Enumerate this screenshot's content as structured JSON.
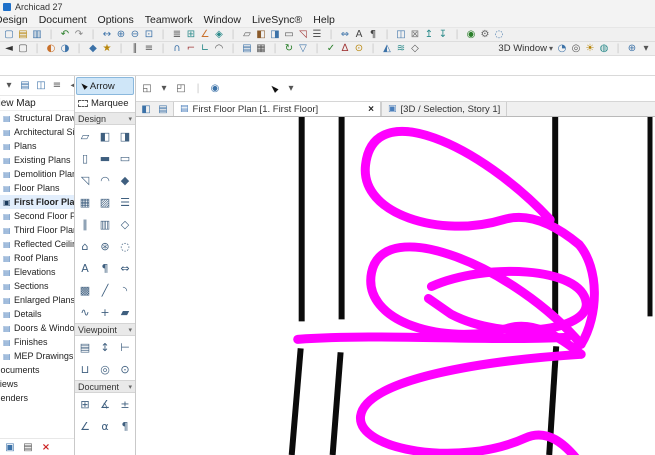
{
  "window": {
    "title": "Archicad 27"
  },
  "menu": {
    "items": [
      {
        "name": "menu-design",
        "label": "Design"
      },
      {
        "name": "menu-document",
        "label": "Document"
      },
      {
        "name": "menu-options",
        "label": "Options"
      },
      {
        "name": "menu-teamwork",
        "label": "Teamwork"
      },
      {
        "name": "menu-window",
        "label": "Window"
      },
      {
        "name": "menu-livesync",
        "label": "LiveSync®"
      },
      {
        "name": "menu-help",
        "label": "Help"
      }
    ]
  },
  "toolbars": {
    "row1": [
      {
        "name": "new-icon",
        "glyph": "▢",
        "color": "#3c72a8"
      },
      {
        "name": "open-icon",
        "glyph": "▤",
        "color": "#b8860b"
      },
      {
        "name": "save-icon",
        "glyph": "▥",
        "color": "#3c72a8"
      },
      {
        "name": "separator",
        "glyph": "|",
        "color": "#c8c8c8",
        "interactable": false
      },
      {
        "name": "undo-icon",
        "glyph": "↶",
        "color": "#2a7f2a"
      },
      {
        "name": "redo-icon",
        "glyph": "↷",
        "color": "#888888"
      },
      {
        "name": "separator",
        "glyph": "|",
        "color": "#c8c8c8",
        "interactable": false
      },
      {
        "name": "pan-icon",
        "glyph": "↔",
        "color": "#3c72a8"
      },
      {
        "name": "zoom-in-icon",
        "glyph": "⊕",
        "color": "#3c72a8"
      },
      {
        "name": "zoom-out-icon",
        "glyph": "⊖",
        "color": "#3c72a8"
      },
      {
        "name": "fit-in-window-icon",
        "glyph": "⊡",
        "color": "#3c72a8"
      },
      {
        "name": "separator",
        "glyph": "|",
        "color": "#c8c8c8",
        "interactable": false
      },
      {
        "name": "layers-icon",
        "glyph": "≣",
        "color": "#555555"
      },
      {
        "name": "grid-snap-icon",
        "glyph": "⊞",
        "color": "#2a8a8a"
      },
      {
        "name": "guide-lines-icon",
        "glyph": "∠",
        "color": "#c9702a"
      },
      {
        "name": "snap-points-icon",
        "glyph": "◈",
        "color": "#2a8a8a"
      },
      {
        "name": "separator",
        "glyph": "|",
        "color": "#c8c8c8",
        "interactable": false
      },
      {
        "name": "wall-icon",
        "glyph": "▱",
        "color": "#555555"
      },
      {
        "name": "door-icon",
        "glyph": "◧",
        "color": "#8a5a2a"
      },
      {
        "name": "window-icon",
        "glyph": "◨",
        "color": "#3c72a8"
      },
      {
        "name": "slab-icon",
        "glyph": "▭",
        "color": "#555555"
      },
      {
        "name": "roof-icon",
        "glyph": "◹",
        "color": "#a23a3a"
      },
      {
        "name": "stair-icon",
        "glyph": "☰",
        "color": "#555555"
      },
      {
        "name": "separator",
        "glyph": "|",
        "color": "#c8c8c8",
        "interactable": false
      },
      {
        "name": "dimension-icon",
        "glyph": "⇔",
        "color": "#3c72a8"
      },
      {
        "name": "text-icon",
        "glyph": "A",
        "color": "#444444"
      },
      {
        "name": "label-icon",
        "glyph": "¶",
        "color": "#444444"
      },
      {
        "name": "separator",
        "glyph": "|",
        "color": "#c8c8c8",
        "interactable": false
      },
      {
        "name": "group-icon",
        "glyph": "◫",
        "color": "#3c72a8"
      },
      {
        "name": "lock-icon",
        "glyph": "⊠",
        "color": "#777777"
      },
      {
        "name": "bring-forward-icon",
        "glyph": "↥",
        "color": "#2a8a8a"
      },
      {
        "name": "send-backward-icon",
        "glyph": "↧",
        "color": "#2a8a8a"
      },
      {
        "name": "separator",
        "glyph": "|",
        "color": "#c8c8c8",
        "interactable": false
      },
      {
        "name": "teamwork-icon",
        "glyph": "◉",
        "color": "#2a7f2a"
      },
      {
        "name": "settings-icon",
        "glyph": "⚙",
        "color": "#666666"
      },
      {
        "name": "search-icon",
        "glyph": "◌",
        "color": "#3c72a8"
      }
    ],
    "row2_left": [
      {
        "name": "arrow-tool-icon",
        "glyph": "◄",
        "color": "#333333"
      },
      {
        "name": "marquee-tool-icon",
        "glyph": "▢",
        "color": "#555555"
      },
      {
        "name": "separator",
        "glyph": "|",
        "color": "#c8c8c8",
        "interactable": false
      },
      {
        "name": "trace-reference-icon",
        "glyph": "◐",
        "color": "#c9702a"
      },
      {
        "name": "virtual-trace-icon",
        "glyph": "◑",
        "color": "#3c72a8"
      },
      {
        "name": "separator",
        "glyph": "|",
        "color": "#c8c8c8",
        "interactable": false
      },
      {
        "name": "element-settings-icon",
        "glyph": "◆",
        "color": "#3c72a8"
      },
      {
        "name": "favorites-icon",
        "glyph": "★",
        "color": "#b8860b"
      },
      {
        "name": "separator",
        "glyph": "|",
        "color": "#c8c8c8",
        "interactable": false
      },
      {
        "name": "align-icon",
        "glyph": "∥",
        "color": "#555555"
      },
      {
        "name": "distribute-icon",
        "glyph": "≡",
        "color": "#555555"
      },
      {
        "name": "separator",
        "glyph": "|",
        "color": "#c8c8c8",
        "interactable": false
      },
      {
        "name": "intersect-icon",
        "glyph": "∩",
        "color": "#3c72a8"
      },
      {
        "name": "trim-icon",
        "glyph": "⌐",
        "color": "#a23a3a"
      },
      {
        "name": "adjust-icon",
        "glyph": "∟",
        "color": "#2a8a8a"
      },
      {
        "name": "fillet-icon",
        "glyph": "◠",
        "color": "#555555"
      },
      {
        "name": "separator",
        "glyph": "|",
        "color": "#c8c8c8",
        "interactable": false
      },
      {
        "name": "stories-icon",
        "glyph": "▤",
        "color": "#3c72a8"
      },
      {
        "name": "layers-dialog-icon",
        "glyph": "▦",
        "color": "#555555"
      },
      {
        "name": "separator",
        "glyph": "|",
        "color": "#c8c8c8",
        "interactable": false
      },
      {
        "name": "renovation-icon",
        "glyph": "↻",
        "color": "#2a7f2a"
      },
      {
        "name": "filter-icon",
        "glyph": "▽",
        "color": "#3c72a8"
      },
      {
        "name": "separator",
        "glyph": "|",
        "color": "#c8c8c8",
        "interactable": false
      },
      {
        "name": "mark-up-icon",
        "glyph": "✓",
        "color": "#2a7f2a"
      },
      {
        "name": "change-manager-icon",
        "glyph": "∆",
        "color": "#a23a3a"
      },
      {
        "name": "issue-icon",
        "glyph": "⊙",
        "color": "#b8860b"
      },
      {
        "name": "separator",
        "glyph": "|",
        "color": "#c8c8c8",
        "interactable": false
      },
      {
        "name": "profile-manager-icon",
        "glyph": "◭",
        "color": "#3c72a8"
      },
      {
        "name": "attributes-icon",
        "glyph": "≋",
        "color": "#2a8a8a"
      },
      {
        "name": "ifc-icon",
        "glyph": "◇",
        "color": "#555555"
      }
    ],
    "row2_label": "3D Window",
    "row2_caret": "▾",
    "row2_right": [
      {
        "name": "3d-style-icon",
        "glyph": "◔",
        "color": "#3c72a8"
      },
      {
        "name": "camera-icon",
        "glyph": "◎",
        "color": "#555555"
      },
      {
        "name": "sun-study-icon",
        "glyph": "☀",
        "color": "#b8860b"
      },
      {
        "name": "render-icon",
        "glyph": "◍",
        "color": "#2a8a8a"
      },
      {
        "name": "separator",
        "glyph": "|",
        "color": "#c8c8c8",
        "interactable": false
      },
      {
        "name": "zoom-level-icon",
        "glyph": "⊕",
        "color": "#3c72a8"
      },
      {
        "name": "dropdown-caret-icon",
        "glyph": "▾",
        "color": "#555555"
      }
    ]
  },
  "navigator": {
    "header": "View Map",
    "top_icons": [
      {
        "name": "project-chooser-icon",
        "glyph": "▾",
        "color": "#555555"
      },
      {
        "name": "navigator-map-icon",
        "glyph": "▤",
        "color": "#3c72a8"
      },
      {
        "name": "organizer-icon",
        "glyph": "◫",
        "color": "#3c72a8"
      },
      {
        "name": "pin-panel-icon",
        "glyph": "≡",
        "color": "#555555"
      },
      {
        "name": "collapse-panel-icon",
        "glyph": "◂",
        "color": "#555555"
      }
    ],
    "tree": [
      {
        "name": "tree-item-structural-drawings",
        "glyph": "▤",
        "label": "Structural Drawings"
      },
      {
        "name": "tree-item-architectural-site",
        "glyph": "▤",
        "label": "Architectural Site"
      },
      {
        "name": "tree-item-plans",
        "glyph": "▤",
        "label": "Plans"
      },
      {
        "name": "tree-item-existing-plans",
        "glyph": "▤",
        "label": "Existing Plans"
      },
      {
        "name": "tree-item-demolition-plans",
        "glyph": "▤",
        "label": "Demolition Plans"
      },
      {
        "name": "tree-item-floor-plans",
        "glyph": "▤",
        "label": "Floor Plans"
      },
      {
        "name": "tree-item-first-floor-plan",
        "glyph": "▣",
        "label": "First Floor Plan",
        "selected": true
      },
      {
        "name": "tree-item-second-floor-plan",
        "glyph": "▤",
        "label": "Second Floor Plan"
      },
      {
        "name": "tree-item-third-floor-plan",
        "glyph": "▤",
        "label": "Third Floor Plan"
      },
      {
        "name": "tree-item-reflected-ceiling-plans",
        "glyph": "▤",
        "label": "Reflected Ceiling Plans"
      },
      {
        "name": "tree-item-roof-plans",
        "glyph": "▤",
        "label": "Roof Plans"
      },
      {
        "name": "tree-item-elevations",
        "glyph": "▤",
        "label": "Elevations"
      },
      {
        "name": "tree-item-sections",
        "glyph": "▤",
        "label": "Sections"
      },
      {
        "name": "tree-item-enlarged-plans",
        "glyph": "▤",
        "label": "Enlarged Plans"
      },
      {
        "name": "tree-item-details",
        "glyph": "▤",
        "label": "Details"
      },
      {
        "name": "tree-item-doors-windows",
        "glyph": "▤",
        "label": "Doors & Windows"
      },
      {
        "name": "tree-item-finishes",
        "glyph": "▤",
        "label": "Finishes"
      },
      {
        "name": "tree-item-mep-drawings",
        "glyph": "▤",
        "label": "MEP Drawings"
      },
      {
        "name": "tree-item-documents",
        "glyph": "",
        "label": "Documents",
        "cls": "root"
      },
      {
        "name": "tree-item-views",
        "glyph": "",
        "label": "Views",
        "cls": "root"
      },
      {
        "name": "tree-item-renders",
        "glyph": "",
        "label": "Renders",
        "cls": "root"
      }
    ],
    "bottom_icons": [
      {
        "name": "view-settings-icon",
        "glyph": "▣",
        "color": "#3c72a8"
      },
      {
        "name": "clone-folder-icon",
        "glyph": "▤",
        "color": "#555555"
      },
      {
        "name": "delete-view-icon",
        "glyph": "×",
        "color": "#cc2222"
      }
    ]
  },
  "toolbox": {
    "arrow_icon": "◄",
    "arrow_label": "Arrow",
    "marquee_label": "Marquee",
    "section_caret": "▾",
    "design": {
      "title": "Design",
      "items": [
        {
          "name": "wall-tool-icon",
          "glyph": "▱"
        },
        {
          "name": "door-tool-icon",
          "glyph": "◧"
        },
        {
          "name": "window-tool-icon",
          "glyph": "◨"
        },
        {
          "name": "column-tool-icon",
          "glyph": "▯"
        },
        {
          "name": "beam-tool-icon",
          "glyph": "▬"
        },
        {
          "name": "slab-tool-icon",
          "glyph": "▭"
        },
        {
          "name": "roof-tool-icon",
          "glyph": "◹"
        },
        {
          "name": "shell-tool-icon",
          "glyph": "◠"
        },
        {
          "name": "morph-tool-icon",
          "glyph": "◆"
        },
        {
          "name": "mesh-tool-icon",
          "glyph": "▦"
        },
        {
          "name": "zone-tool-icon",
          "glyph": "▨"
        },
        {
          "name": "stair-tool-icon",
          "glyph": "☰"
        },
        {
          "name": "railing-tool-icon",
          "glyph": "∥"
        },
        {
          "name": "curtain-wall-tool-icon",
          "glyph": "▥"
        },
        {
          "name": "skylight-tool-icon",
          "glyph": "◇"
        },
        {
          "name": "object-tool-icon",
          "glyph": "⌂"
        },
        {
          "name": "lamp-tool-icon",
          "glyph": "⊛"
        },
        {
          "name": "opening-tool-icon",
          "glyph": "◌"
        },
        {
          "name": "text-tool-icon",
          "glyph": "A"
        },
        {
          "name": "label-tool-icon",
          "glyph": "¶"
        },
        {
          "name": "dimension-tool-icon",
          "glyph": "⇔"
        },
        {
          "name": "fill-tool-icon",
          "glyph": "▩"
        },
        {
          "name": "line-tool-icon",
          "glyph": "╱"
        },
        {
          "name": "arc-tool-icon",
          "glyph": "◝"
        },
        {
          "name": "spline-tool-icon",
          "glyph": "∿"
        },
        {
          "name": "hotspot-tool-icon",
          "glyph": "+"
        },
        {
          "name": "figure-tool-icon",
          "glyph": "▰"
        }
      ]
    },
    "viewpoint": {
      "title": "Viewpoint",
      "items": [
        {
          "name": "story-tool-icon",
          "glyph": "▤"
        },
        {
          "name": "section-tool-icon",
          "glyph": "↕"
        },
        {
          "name": "elevation-tool-icon",
          "glyph": "⊢"
        },
        {
          "name": "interior-elevation-tool-icon",
          "glyph": "⊔"
        },
        {
          "name": "camera-tool-icon",
          "glyph": "◎"
        },
        {
          "name": "detail-tool-icon",
          "glyph": "⊙"
        }
      ]
    },
    "document": {
      "title": "Document",
      "items": [
        {
          "name": "drawing-tool-icon",
          "glyph": "⊞"
        },
        {
          "name": "worksheet-tool-icon",
          "glyph": "∡"
        },
        {
          "name": "level-dimension-tool-icon",
          "glyph": "±"
        },
        {
          "name": "angle-dimension-tool-icon",
          "glyph": "∠"
        },
        {
          "name": "text-annotation-tool-icon",
          "glyph": "α"
        },
        {
          "name": "label-annotation-tool-icon",
          "glyph": "¶"
        }
      ]
    }
  },
  "options_bar": {
    "icons": [
      {
        "name": "selection-style-icon",
        "glyph": "◱",
        "color": "#555555"
      },
      {
        "name": "dropdown-caret-icon",
        "glyph": "▾",
        "color": "#555555"
      },
      {
        "name": "marquee-style-icon",
        "glyph": "◰",
        "color": "#555555"
      },
      {
        "name": "separator",
        "glyph": "|",
        "color": "#c8c8c8",
        "interactable": false
      },
      {
        "name": "snap-guides-icon",
        "glyph": "◉",
        "color": "#3c72a8"
      },
      {
        "name": "arrow-cursor-icon",
        "glyph": "◄",
        "color": "#111111",
        "cls": "cursor-rot"
      },
      {
        "name": "dropdown-caret-icon",
        "glyph": "▾",
        "color": "#555555"
      }
    ]
  },
  "tabbar": {
    "left_icons": [
      {
        "name": "quick-options-icon",
        "glyph": "◧",
        "color": "#3c72a8"
      },
      {
        "name": "pop-up-navigator-icon",
        "glyph": "▤",
        "color": "#3c72a8"
      }
    ],
    "tab1": {
      "icon": "▤",
      "label": "First Floor Plan [1. First Floor]",
      "close": "×"
    },
    "tab2": {
      "icon": "▣",
      "label": "[3D / Selection, Story 1]"
    }
  },
  "canvas": {
    "magenta_color": "#FF00FF",
    "wall_color": "#0b0b0b",
    "background": "#ffffff"
  }
}
